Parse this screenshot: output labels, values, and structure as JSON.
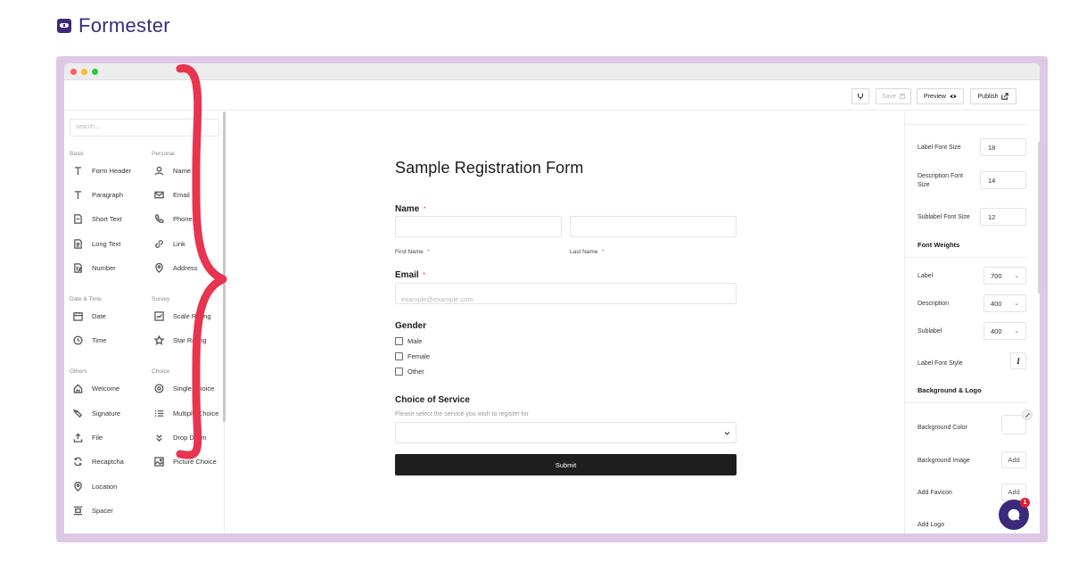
{
  "brand": {
    "name": "Formester"
  },
  "toolbar": {
    "save_label": "Save",
    "preview_label": "Preview",
    "publish_label": "Publish"
  },
  "sidebar": {
    "search_placeholder": "search...",
    "groups": {
      "basic": "Basic",
      "personal": "Personal",
      "datetime": "Date & Time",
      "survey": "Survey",
      "others": "Others",
      "choice": "Choice"
    },
    "items": {
      "form_header": "Form Header",
      "paragraph": "Paragraph",
      "short_text": "Short Text",
      "long_text": "Long Text",
      "number": "Number",
      "name": "Name",
      "email": "Email",
      "phone": "Phone",
      "link": "Link",
      "address": "Address",
      "date": "Date",
      "time": "Time",
      "scale_rating": "Scale Rating",
      "star_rating": "Star Rating",
      "welcome": "Welcome",
      "signature": "Signature",
      "file": "File",
      "recaptcha": "Recaptcha",
      "location": "Location",
      "spacer": "Spacer",
      "single_choice": "Single Choice",
      "multiple_choice": "Multiple Choice",
      "drop_down": "Drop Down",
      "picture_choice": "Picture Choice"
    }
  },
  "form": {
    "title": "Sample Registration Form",
    "name_label": "Name",
    "required_mark": "*",
    "first_name_sublabel": "First Name",
    "last_name_sublabel": "Last Name",
    "email_label": "Email",
    "email_placeholder": "example@example.com",
    "gender_label": "Gender",
    "gender_options": [
      "Male",
      "Female",
      "Other"
    ],
    "service_label": "Choice of Service",
    "service_description": "Please select the service you wish to register for",
    "submit_label": "Submit"
  },
  "panel": {
    "label_font_size_label": "Label Font Size",
    "label_font_size_value": "18",
    "description_font_size_label": "Description Font Size",
    "description_font_size_value": "14",
    "sublabel_font_size_label": "Sublabel Font Size",
    "sublabel_font_size_value": "12",
    "font_weights_heading": "Font Weights",
    "label_weight_label": "Label",
    "label_weight_value": "700",
    "description_weight_label": "Description",
    "description_weight_value": "400",
    "sublabel_weight_label": "Sublabel",
    "sublabel_weight_value": "400",
    "label_font_style_label": "Label Font Style",
    "background_logo_heading": "Background & Logo",
    "background_color_label": "Background Color",
    "background_image_label": "Background Image",
    "add_favicon_label": "Add Favicon",
    "add_logo_label": "Add Logo",
    "add_button_label": "Add"
  },
  "chat": {
    "badge_count": "1"
  },
  "colors": {
    "brand": "#3b2a7c",
    "frame": "#ddc8e6",
    "brace": "#e8344e",
    "submit_bg": "#1f1f1f",
    "required": "#e2556a"
  }
}
